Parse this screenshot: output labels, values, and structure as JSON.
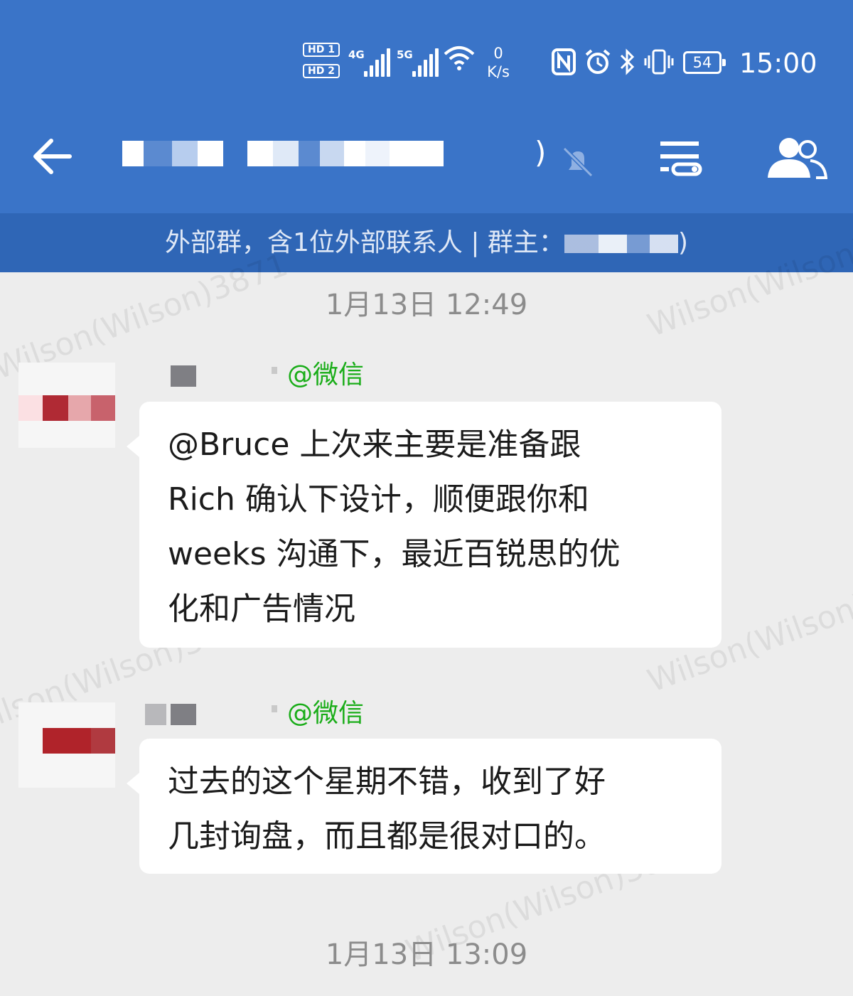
{
  "status_bar": {
    "hd1": "HD 1",
    "hd2": "HD 2",
    "network1": "4G",
    "network2": "5G",
    "speed_value": "0",
    "speed_unit": "K/s",
    "battery": "54",
    "time": "15:00"
  },
  "header": {
    "title_suffix": ")"
  },
  "notice": {
    "text": "外部群，含1位外部联系人 | 群主：",
    "owner_suffix": ")"
  },
  "watermark": "Wilson(Wilson)3871",
  "messages": [
    {
      "timestamp": "1月13日  12:49",
      "sender_tag": "@微信",
      "lines": [
        "@Bruce  上次来主要是准备跟",
        "Rich 确认下设计，顺便跟你和",
        "weeks 沟通下，最近百锐思的优",
        "化和广告情况"
      ]
    },
    {
      "sender_tag": "@微信",
      "lines": [
        "过去的这个星期不错，收到了好",
        "几封询盘，而且都是很对口的。"
      ]
    }
  ],
  "timestamp2": "1月13日  13:09",
  "colors": {
    "header_blue": "#3a74c8",
    "notice_blue": "#2f66b6",
    "chat_bg": "#ededed",
    "wechat_green": "#1aad19"
  },
  "icons": [
    "back-arrow-icon",
    "mute-bell-icon",
    "group-menu-icon",
    "members-icon",
    "wifi-icon",
    "nfc-icon",
    "alarm-icon",
    "bluetooth-icon",
    "vibrate-icon"
  ]
}
